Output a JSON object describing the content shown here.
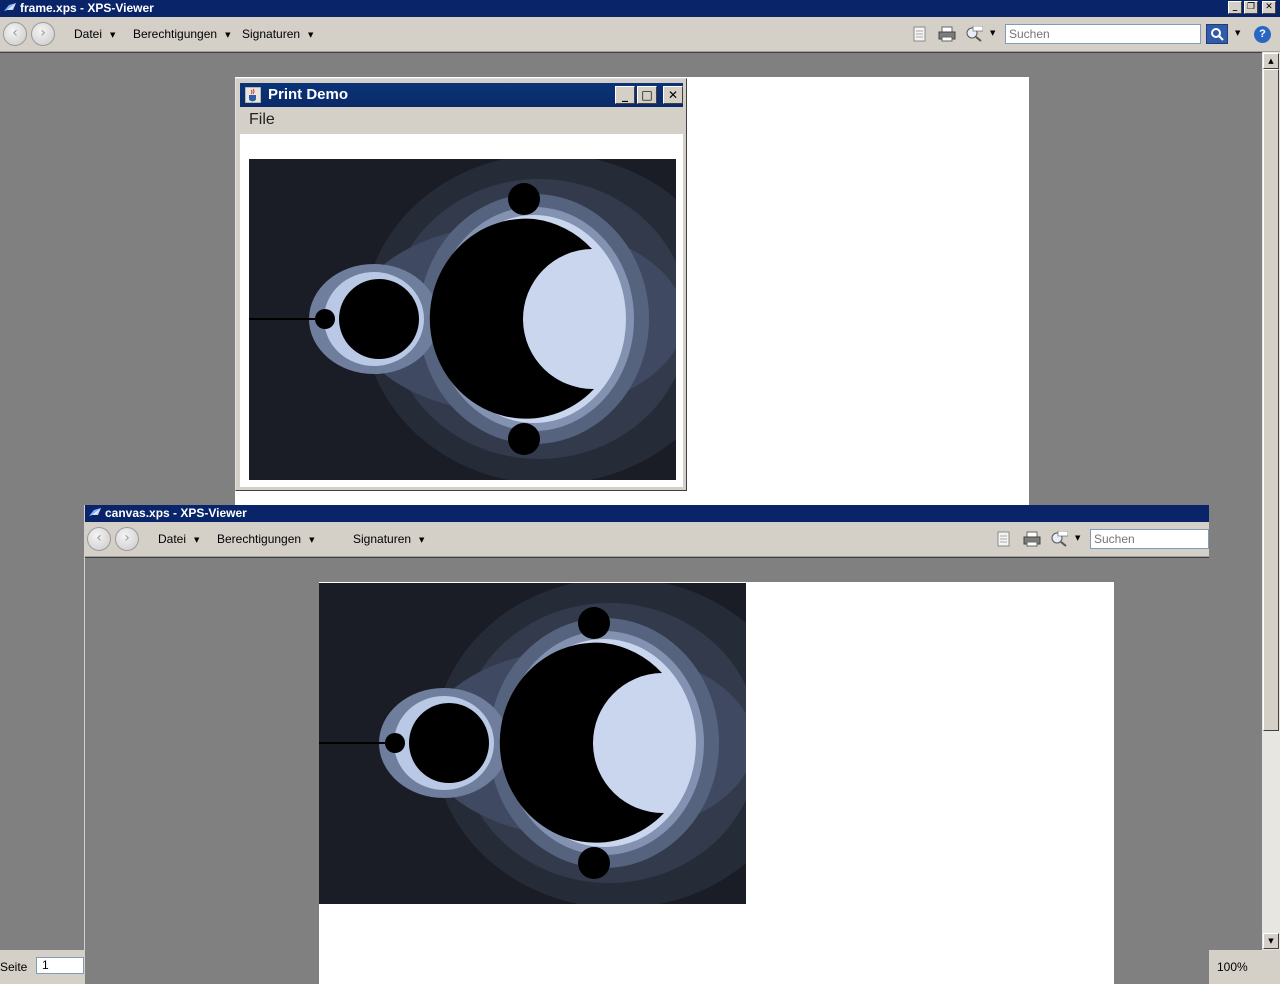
{
  "win1": {
    "title": "frame.xps - XPS-Viewer",
    "menu": [
      "Datei",
      "Berechtigungen",
      "Signaturen"
    ],
    "search_placeholder": "Suchen",
    "status": {
      "page_label": "Seite",
      "page_value": "1",
      "zoom": "100%"
    }
  },
  "java_frame": {
    "title": "Print Demo",
    "menu_file": "File"
  },
  "win2": {
    "title": "canvas.xps - XPS-Viewer",
    "menu": [
      "Datei",
      "Berechtigungen",
      "Signaturen"
    ],
    "search_placeholder": "Suchen"
  },
  "colors": {
    "titlebar": "#0a246a",
    "chrome": "#d4d0c8",
    "workspace": "#808080",
    "page": "#ffffff"
  },
  "icons": [
    "back-icon",
    "forward-icon",
    "page-icon",
    "print-icon",
    "zoom-icon",
    "search-icon",
    "help-icon",
    "java-cup-icon",
    "fractal-image"
  ]
}
